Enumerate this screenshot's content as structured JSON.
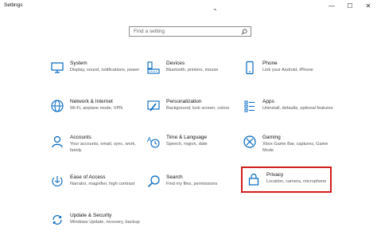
{
  "window": {
    "title": "Settings",
    "minimize": "—",
    "maximize": "☐",
    "close": "✕"
  },
  "search": {
    "placeholder": "Find a setting"
  },
  "tiles": [
    {
      "label": "System",
      "desc": "Display, sound, notifications, power"
    },
    {
      "label": "Devices",
      "desc": "Bluetooth, printers, mouse"
    },
    {
      "label": "Phone",
      "desc": "Link your Android, iPhone"
    },
    {
      "label": "Network & Internet",
      "desc": "Wi-Fi, airplane mode, VPN"
    },
    {
      "label": "Personalization",
      "desc": "Background, lock screen, colors"
    },
    {
      "label": "Apps",
      "desc": "Uninstall, defaults, optional features"
    },
    {
      "label": "Accounts",
      "desc": "Your accounts, email, sync, work, family"
    },
    {
      "label": "Time & Language",
      "desc": "Speech, region, date"
    },
    {
      "label": "Gaming",
      "desc": "Xbox Game Bar, captures, Game Mode"
    },
    {
      "label": "Ease of Access",
      "desc": "Narrator, magnifier, high contrast"
    },
    {
      "label": "Search",
      "desc": "Find my files, permissions"
    },
    {
      "label": "Privacy",
      "desc": "Location, camera, microphone"
    },
    {
      "label": "Update & Security",
      "desc": "Windows Update, recovery, backup"
    }
  ],
  "colors": {
    "accent": "#0067c0",
    "highlight": "#d31c1c"
  }
}
